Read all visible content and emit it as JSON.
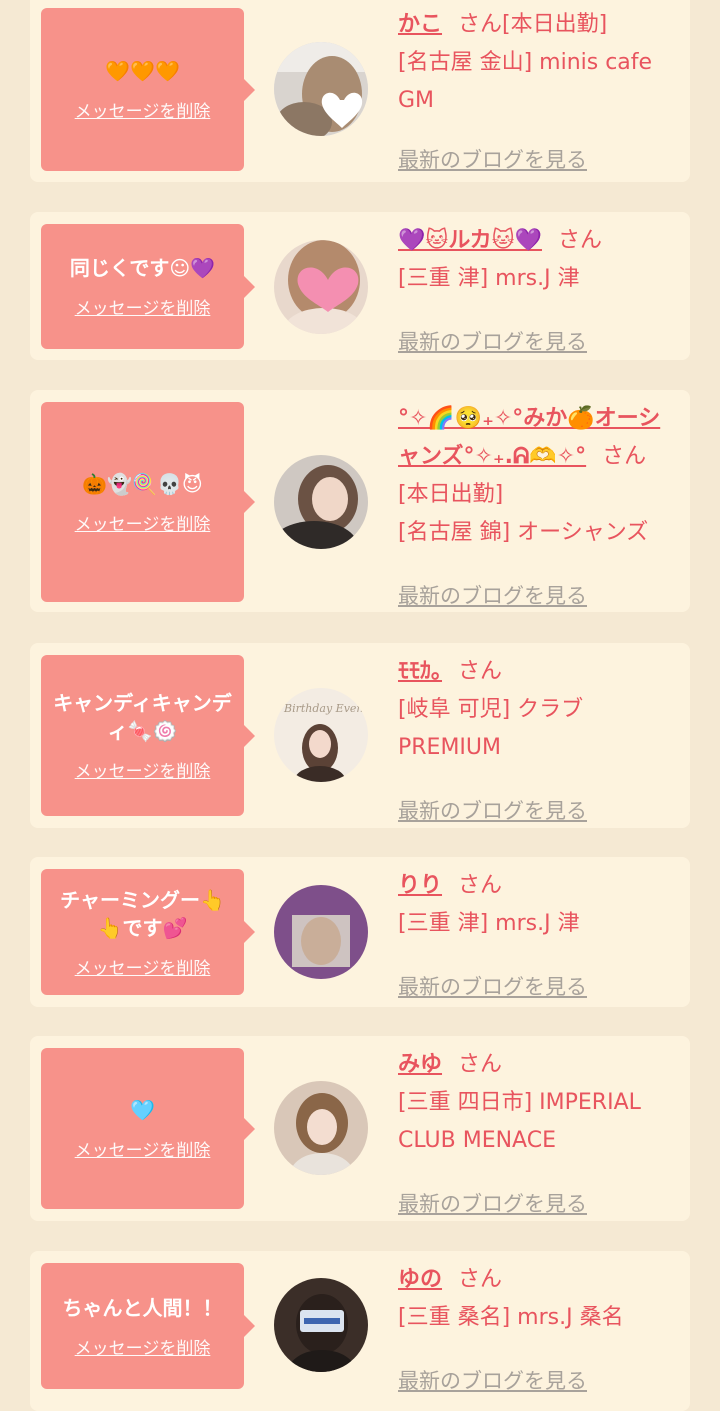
{
  "messages": [
    {
      "message": "🧡🧡🧡",
      "delete_label": "メッセージを削除",
      "name": "かこ",
      "suffix": "さん",
      "status": "[本日出勤]",
      "shop": "[名古屋 金山] minis cafe GM",
      "blog_link": "最新のブログを見る"
    },
    {
      "message": "同じくです☺︎💜",
      "delete_label": "メッセージを削除",
      "name": "💜🐱ルカ🐱💜",
      "suffix": "さん",
      "shop": "[三重 津] mrs.J 津",
      "blog_link": "最新のブログを見る"
    },
    {
      "message": "🎃👻🍭💀😈",
      "delete_label": "メッセージを削除",
      "name": "°✧🌈🥺₊✧°みか🍊オーシャンズ°✧₊.ᕱ🫶✧°",
      "suffix": "さん",
      "status": "[本日出勤]",
      "shop": "[名古屋 錦] オーシャンズ",
      "blog_link": "最新のブログを見る"
    },
    {
      "message": "キャンディキャンディ🍬🍥",
      "delete_label": "メッセージを削除",
      "name": "ﾓﾓｶ｡",
      "suffix": "さん",
      "shop": "[岐阜 可児] クラブ PREMIUM",
      "blog_link": "最新のブログを見る"
    },
    {
      "message": "チャーミングー👆👆です💕",
      "delete_label": "メッセージを削除",
      "name": "りり",
      "suffix": "さん",
      "shop": "[三重 津] mrs.J 津",
      "blog_link": "最新のブログを見る"
    },
    {
      "message": "🩵",
      "delete_label": "メッセージを削除",
      "name": "みゆ",
      "suffix": "さん",
      "shop": "[三重 四日市] IMPERIAL CLUB MENACE",
      "blog_link": "最新のブログを見る"
    },
    {
      "message": "ちゃんと人間！！",
      "delete_label": "メッセージを削除",
      "name": "ゆの",
      "suffix": "さん",
      "shop": "[三重 桑名] mrs.J 桑名",
      "blog_link": "最新のブログを見る"
    }
  ],
  "avatar_image": {
    "birthday_text": "Birthday Event"
  }
}
